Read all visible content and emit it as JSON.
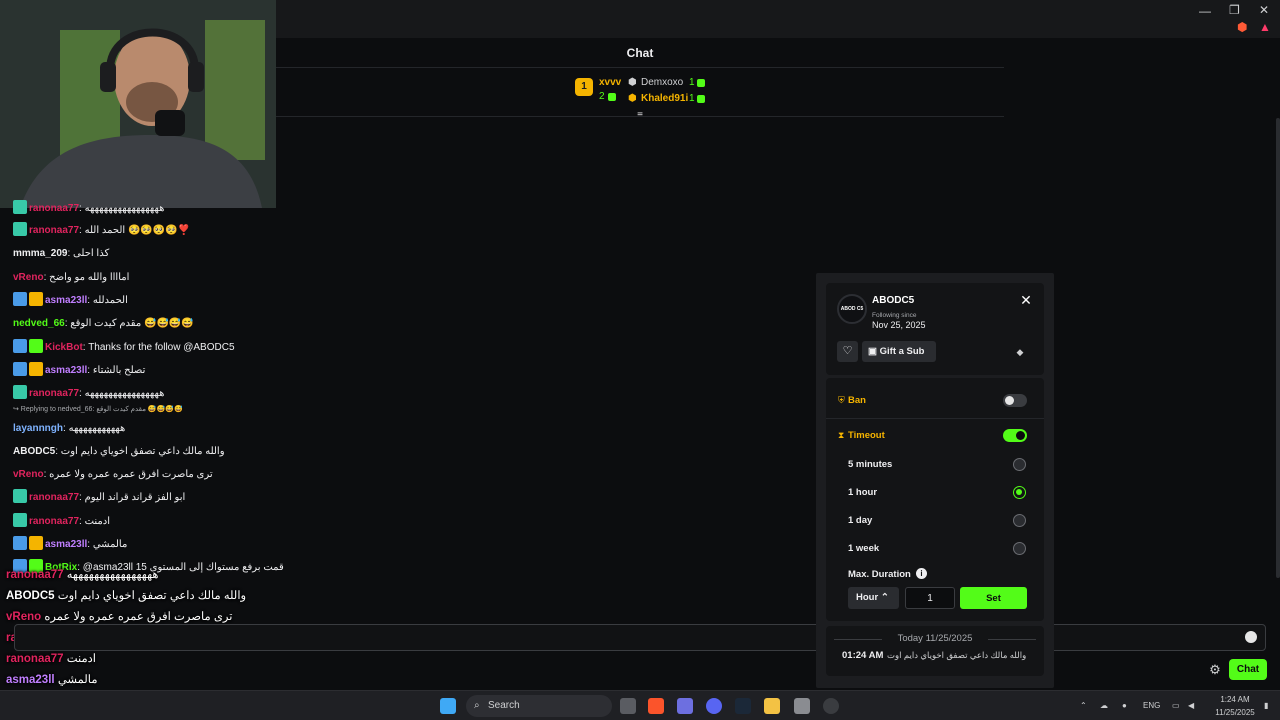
{
  "app": {
    "chat_title": "Chat"
  },
  "leaderboard": [
    {
      "rank": "1",
      "name": "xvvv",
      "color": "#f5b400"
    },
    {
      "rank": "2",
      "name": ""
    },
    {
      "name": "Demxoxo",
      "count": "1",
      "color": "#cfd0d2"
    },
    {
      "name": "Khaled91i",
      "count": "1",
      "color": "#f5b400"
    }
  ],
  "chat": [
    {
      "user": "ranonaa77",
      "color": "#e0245e",
      "text": "ههههههههههههههههه",
      "badges": [
        "teal"
      ]
    },
    {
      "user": "ranonaa77",
      "color": "#e0245e",
      "text": "الحمد الله 🥺🥺🥺🥺❣️",
      "badges": [
        "teal"
      ]
    },
    {
      "user": "mmma_209",
      "color": "#efeff1",
      "text": "كذا احلى",
      "badges": []
    },
    {
      "user": "vReno",
      "color": "#e0245e",
      "text": "اماااا والله مو واضح",
      "badges": []
    },
    {
      "user": "asma23ll",
      "color": "#c07fff",
      "text": "الحمدلله",
      "badges": [
        "blue",
        "gold"
      ]
    },
    {
      "user": "nedved_66",
      "color": "#53fc18",
      "text": "مقدم كيدت الوقع 😅😅😅😅",
      "badges": []
    },
    {
      "user": "KickBot",
      "color": "#e0245e",
      "text": "Thanks for the follow @ABODC5",
      "badges": [
        "blue",
        "green"
      ]
    },
    {
      "user": "asma23ll",
      "color": "#c07fff",
      "text": "تصلح بالشتاء",
      "badges": [
        "blue",
        "gold"
      ]
    },
    {
      "user": "ranonaa77",
      "color": "#e0245e",
      "text": "ههههههههههههههههه",
      "badges": [
        "teal"
      ]
    },
    {
      "user": "",
      "color": "#a7a9ad",
      "text": "↪ Replying to nedved_66: مقدم كيدت الوقع 😅😅😅😅",
      "badges": []
    },
    {
      "user": "layannngh",
      "color": "#7fb3ff",
      "text": "هههههههههههه",
      "badges": []
    },
    {
      "user": "ABODC5",
      "color": "#efeff1",
      "text": "والله مالك داعي تصفق اخوياي دايم اوت",
      "badges": []
    },
    {
      "user": "vReno",
      "color": "#e0245e",
      "text": "ترى ماصرت افرق عمره عمره ولا عمره",
      "badges": []
    },
    {
      "user": "ranonaa77",
      "color": "#e0245e",
      "text": "ابو الفز قراند قراند اليوم",
      "badges": [
        "teal"
      ]
    },
    {
      "user": "ranonaa77",
      "color": "#e0245e",
      "text": "ادمنت",
      "badges": [
        "teal"
      ]
    },
    {
      "user": "asma23ll",
      "color": "#c07fff",
      "text": "مالمشي",
      "badges": [
        "blue",
        "gold"
      ]
    },
    {
      "user": "BotRix",
      "color": "#53fc18",
      "text": "@asma23ll 15 قمت برفع مستواك إلى المستوى",
      "badges": [
        "blue",
        "green"
      ]
    }
  ],
  "overlay": [
    {
      "user": "ranonaa77",
      "color": "#e0245e",
      "text": "ههههههههههههههههه"
    },
    {
      "user": "ABODC5",
      "color": "#ffffff",
      "text": "والله مالك داعي تصفق اخوياي دايم اوت"
    },
    {
      "user": "vReno",
      "color": "#e0245e",
      "text": "ترى ماصرت افرق عمره عمره ولا عمره"
    },
    {
      "user": "ranonaa77",
      "color": "#e0245e",
      "text": "ابو الفز قراند قراند اليوم"
    },
    {
      "user": "ranonaa77",
      "color": "#e0245e",
      "text": "ادمنت"
    },
    {
      "user": "asma23ll",
      "color": "#c07fff",
      "text": "مالمشي"
    },
    {
      "user": "BotRix",
      "color": "#53fc18",
      "text": "@asma23ll 15 قمت برفع مستواك إلى المستوى"
    }
  ],
  "input": {
    "send_label": "Chat"
  },
  "mod_panel": {
    "avatar_text": "ABOD C5",
    "username": "ABODC5",
    "following_label": "Following since",
    "following_date": "Nov 25, 2025",
    "gift_label": "Gift a Sub",
    "ban_label": "Ban",
    "ban_on": false,
    "timeout_label": "Timeout",
    "timeout_on": true,
    "options": [
      {
        "label": "5 minutes",
        "selected": false
      },
      {
        "label": "1 hour",
        "selected": true
      },
      {
        "label": "1 day",
        "selected": false
      },
      {
        "label": "1 week",
        "selected": false
      }
    ],
    "max_duration_label": "Max. Duration",
    "unit": "Hour",
    "duration_value": "1",
    "set_label": "Set",
    "history_date": "Today 11/25/2025",
    "history_time": "01:24 AM",
    "history_text": "والله مالك داعي تصفق اخوياي دايم اوت"
  },
  "taskbar": {
    "search_placeholder": "Search",
    "lang": "ENG",
    "time": "1:24 AM",
    "date": "11/25/2025"
  },
  "colors": {
    "accent": "#53fc18",
    "warn": "#f5b400",
    "bg": "#0c0d0f"
  }
}
